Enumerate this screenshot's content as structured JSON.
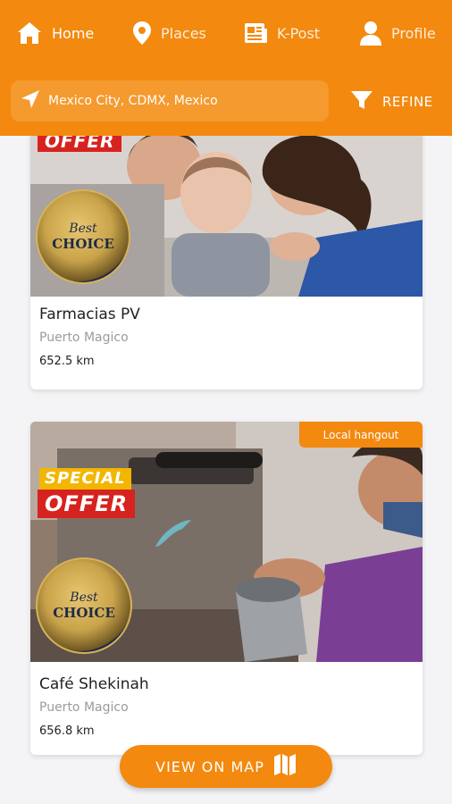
{
  "nav": {
    "items": [
      {
        "label": "Home",
        "icon": "home-icon"
      },
      {
        "label": "Places",
        "icon": "map-pin-icon"
      },
      {
        "label": "K-Post",
        "icon": "news-icon"
      },
      {
        "label": "Profile",
        "icon": "user-icon"
      }
    ]
  },
  "location": {
    "value": "Mexico City, CDMX, Mexico",
    "icon": "navigation-arrow-icon"
  },
  "refine": {
    "label": "REFINE",
    "icon": "filter-icon"
  },
  "cards": [
    {
      "title": "Farmacias PV",
      "subtitle": "Puerto Magico",
      "distance": "652.5 km",
      "offer": "OFFER",
      "seal_top": "Best",
      "seal_bottom": "CHOICE"
    },
    {
      "title": "Café Shekinah",
      "subtitle": "Puerto Magico",
      "distance": "656.8 km",
      "badge": "Local hangout",
      "special": "SPECIAL",
      "offer": "OFFER",
      "seal_top": "Best",
      "seal_bottom": "CHOICE"
    }
  ],
  "map_button": {
    "label": "VIEW ON MAP",
    "icon": "map-icon"
  },
  "colors": {
    "accent": "#f3890f",
    "background": "#f4f4f6",
    "offer_red": "#d6231f"
  }
}
